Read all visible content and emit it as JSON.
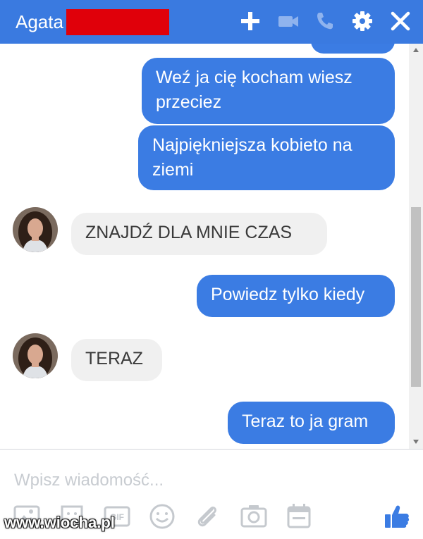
{
  "header": {
    "title": "Agata",
    "icons": [
      "plus-icon",
      "video-camera-icon",
      "phone-icon",
      "gear-icon",
      "close-icon"
    ],
    "accent_color": "#3a7ae0"
  },
  "messages": [
    {
      "direction": "outgoing",
      "text_lines": [
        "Weź ja cię kocham wiesz",
        "przeciez"
      ]
    },
    {
      "direction": "outgoing",
      "text_lines": [
        "Najpiękniejsza kobieto na",
        "ziemi"
      ]
    },
    {
      "direction": "incoming",
      "text_lines": [
        "ZNAJDŹ DLA MNIE CZAS"
      ]
    },
    {
      "direction": "outgoing",
      "text_lines": [
        "Powiedz tylko kiedy"
      ]
    },
    {
      "direction": "incoming",
      "text_lines": [
        "TERAZ"
      ]
    },
    {
      "direction": "outgoing",
      "text_lines": [
        "Teraz to ja gram"
      ]
    }
  ],
  "composer": {
    "placeholder": "Wpisz wiadomość...",
    "toolbar_icons": [
      "photo-icon",
      "sticker-icon",
      "gif-icon",
      "emoji-icon",
      "attachment-icon",
      "camera-icon",
      "calendar-icon",
      "thumbs-up-icon"
    ],
    "gif_label": "GIF"
  },
  "watermark": "www.wiocha.pl",
  "colors": {
    "outgoing_bubble": "#3b7ce3",
    "incoming_bubble": "#f0f0f0",
    "redaction": "#e0000a"
  }
}
